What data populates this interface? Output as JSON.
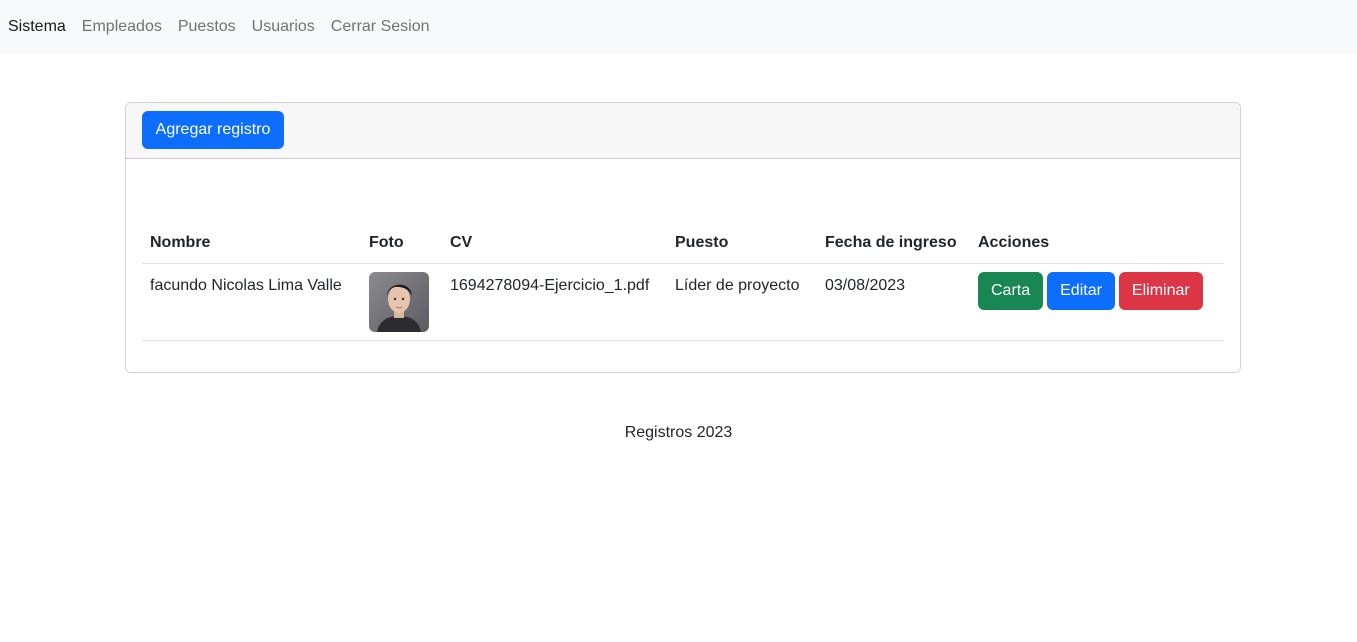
{
  "navbar": {
    "brand": "Sistema",
    "links": [
      "Empleados",
      "Puestos",
      "Usuarios",
      "Cerrar Sesion"
    ]
  },
  "card": {
    "add_button": "Agregar registro"
  },
  "table": {
    "headers": [
      "Nombre",
      "Foto",
      "CV",
      "Puesto",
      "Fecha de ingreso",
      "Acciones"
    ],
    "rows": [
      {
        "nombre": "facundo Nicolas Lima Valle",
        "cv": "1694278094-Ejercicio_1.pdf",
        "puesto": "Líder de proyecto",
        "fecha": "03/08/2023",
        "actions": {
          "carta": "Carta",
          "editar": "Editar",
          "eliminar": "Eliminar"
        }
      }
    ]
  },
  "footer": {
    "text": "Registros 2023"
  },
  "colors": {
    "primary": "#0d6efd",
    "success": "#198754",
    "danger": "#dc3545",
    "navbar_bg": "#f8f9fa"
  }
}
